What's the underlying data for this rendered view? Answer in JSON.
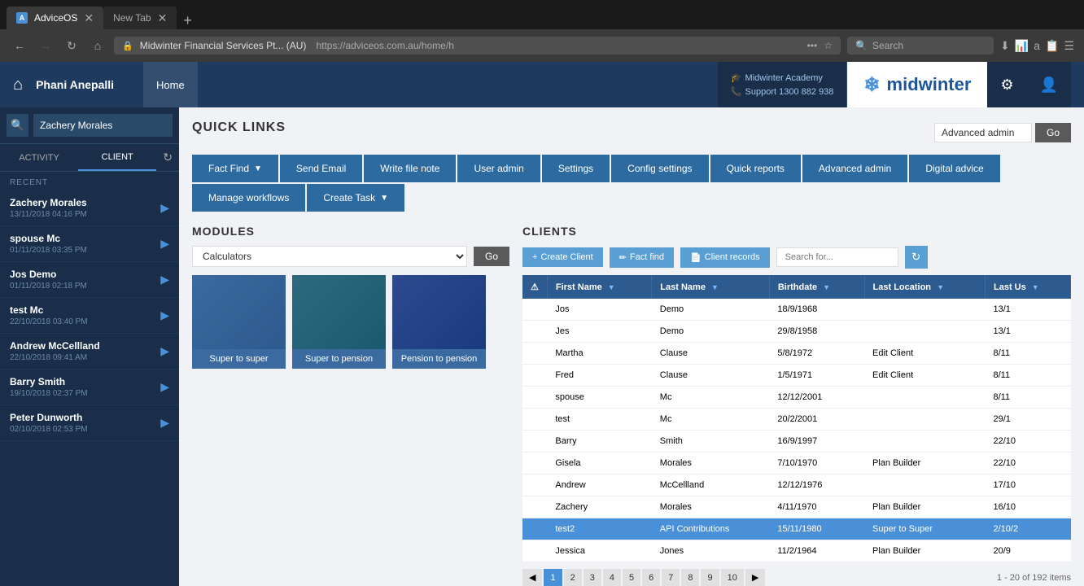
{
  "browser": {
    "tabs": [
      {
        "id": "adviceos",
        "label": "AdviceOS",
        "active": true,
        "icon": "A"
      },
      {
        "id": "newtab",
        "label": "New Tab",
        "active": false,
        "icon": "N"
      }
    ],
    "url": "https://adviceos.com.au/home/h",
    "url_display": "Midwinter Financial Services Pt... (AU)",
    "search_placeholder": "Search"
  },
  "header": {
    "home_icon": "⌂",
    "user_name": "Phani Anepalli",
    "nav_items": [
      "Home"
    ],
    "academy_label": "Midwinter Academy",
    "support_label": "Support 1300 882 938",
    "logo_text": "midwinter",
    "settings_icon": "⚙",
    "user_icon": "👤"
  },
  "sidebar": {
    "search_placeholder": "Zachery Morales",
    "tabs": [
      "ACTIVITY",
      "CLIENT"
    ],
    "recent_label": "RECENT",
    "clients": [
      {
        "name": "Zachery Morales",
        "date": "13/11/2018 04:16 PM"
      },
      {
        "name": "spouse Mc",
        "date": "01/11/2018 03:35 PM"
      },
      {
        "name": "Jos Demo",
        "date": "01/11/2018 02:18 PM"
      },
      {
        "name": "test Mc",
        "date": "22/10/2018 03:40 PM"
      },
      {
        "name": "Andrew McCellland",
        "date": "22/10/2018 09:41 AM"
      },
      {
        "name": "Barry Smith",
        "date": "19/10/2018 02:37 PM"
      },
      {
        "name": "Peter Dunworth",
        "date": "02/10/2018 02:53 PM"
      }
    ]
  },
  "quick_links": {
    "title": "QUICK LINKS",
    "admin_options": [
      "Advanced admin"
    ],
    "go_label": "Go",
    "buttons": [
      {
        "id": "fact-find",
        "label": "Fact Find",
        "has_dropdown": true
      },
      {
        "id": "send-email",
        "label": "Send Email",
        "has_dropdown": false
      },
      {
        "id": "write-file-note",
        "label": "Write file note",
        "has_dropdown": false
      },
      {
        "id": "user-admin",
        "label": "User admin",
        "has_dropdown": false
      },
      {
        "id": "settings",
        "label": "Settings",
        "has_dropdown": false
      },
      {
        "id": "config-settings",
        "label": "Config settings",
        "has_dropdown": false
      },
      {
        "id": "quick-reports",
        "label": "Quick reports",
        "has_dropdown": false
      },
      {
        "id": "advanced-admin",
        "label": "Advanced admin",
        "has_dropdown": false
      },
      {
        "id": "digital-advice",
        "label": "Digital advice",
        "has_dropdown": false
      },
      {
        "id": "manage-workflows",
        "label": "Manage workflows",
        "has_dropdown": false
      },
      {
        "id": "create-task",
        "label": "Create Task",
        "has_dropdown": true
      }
    ]
  },
  "modules": {
    "title": "MODULES",
    "select_options": [
      "Calculators"
    ],
    "go_label": "Go",
    "cards": [
      {
        "id": "super-to-super",
        "label": "Super to super"
      },
      {
        "id": "super-to-pension",
        "label": "Super to pension"
      },
      {
        "id": "pension-to-pension",
        "label": "Pension to pension"
      }
    ]
  },
  "clients": {
    "title": "CLIENTS",
    "create_label": "Create Client",
    "fact_find_label": "Fact find",
    "client_records_label": "Client records",
    "search_placeholder": "Search for...",
    "columns": [
      {
        "id": "warn",
        "label": "⚠",
        "sortable": false
      },
      {
        "id": "first-name",
        "label": "First Name",
        "sortable": true
      },
      {
        "id": "last-name",
        "label": "Last Name",
        "sortable": true
      },
      {
        "id": "birthdate",
        "label": "Birthdate",
        "sortable": true
      },
      {
        "id": "last-location",
        "label": "Last Location",
        "sortable": true
      },
      {
        "id": "last-us",
        "label": "Last Us",
        "sortable": true
      }
    ],
    "rows": [
      {
        "warn": "",
        "first": "Jos",
        "last": "Demo",
        "birthdate": "18/9/1968",
        "location": "",
        "last_us": "13/1",
        "selected": false
      },
      {
        "warn": "",
        "first": "Jes",
        "last": "Demo",
        "birthdate": "29/8/1958",
        "location": "",
        "last_us": "13/1",
        "selected": false
      },
      {
        "warn": "",
        "first": "Martha",
        "last": "Clause",
        "birthdate": "5/8/1972",
        "location": "Edit Client",
        "last_us": "8/11",
        "selected": false
      },
      {
        "warn": "",
        "first": "Fred",
        "last": "Clause",
        "birthdate": "1/5/1971",
        "location": "Edit Client",
        "last_us": "8/11",
        "selected": false
      },
      {
        "warn": "",
        "first": "spouse",
        "last": "Mc",
        "birthdate": "12/12/2001",
        "location": "",
        "last_us": "8/11",
        "selected": false
      },
      {
        "warn": "",
        "first": "test",
        "last": "Mc",
        "birthdate": "20/2/2001",
        "location": "",
        "last_us": "29/1",
        "selected": false
      },
      {
        "warn": "",
        "first": "Barry",
        "last": "Smith",
        "birthdate": "16/9/1997",
        "location": "",
        "last_us": "22/10",
        "selected": false
      },
      {
        "warn": "",
        "first": "Gisela",
        "last": "Morales",
        "birthdate": "7/10/1970",
        "location": "Plan Builder",
        "last_us": "22/10",
        "selected": false
      },
      {
        "warn": "",
        "first": "Andrew",
        "last": "McCellland",
        "birthdate": "12/12/1976",
        "location": "",
        "last_us": "17/10",
        "selected": false
      },
      {
        "warn": "",
        "first": "Zachery",
        "last": "Morales",
        "birthdate": "4/11/1970",
        "location": "Plan Builder",
        "last_us": "16/10",
        "selected": false
      },
      {
        "warn": "",
        "first": "test2",
        "last": "API Contributions",
        "birthdate": "15/11/1980",
        "location": "Super to Super",
        "last_us": "2/10/2",
        "selected": true
      },
      {
        "warn": "",
        "first": "Jessica",
        "last": "Jones",
        "birthdate": "11/2/1964",
        "location": "Plan Builder",
        "last_us": "20/9",
        "selected": false
      }
    ],
    "pagination": {
      "pages": [
        1,
        2,
        3,
        4,
        5,
        6,
        7,
        8,
        9,
        10
      ],
      "current_page": 1,
      "total_info": "1 - 20 of 192 items"
    }
  }
}
